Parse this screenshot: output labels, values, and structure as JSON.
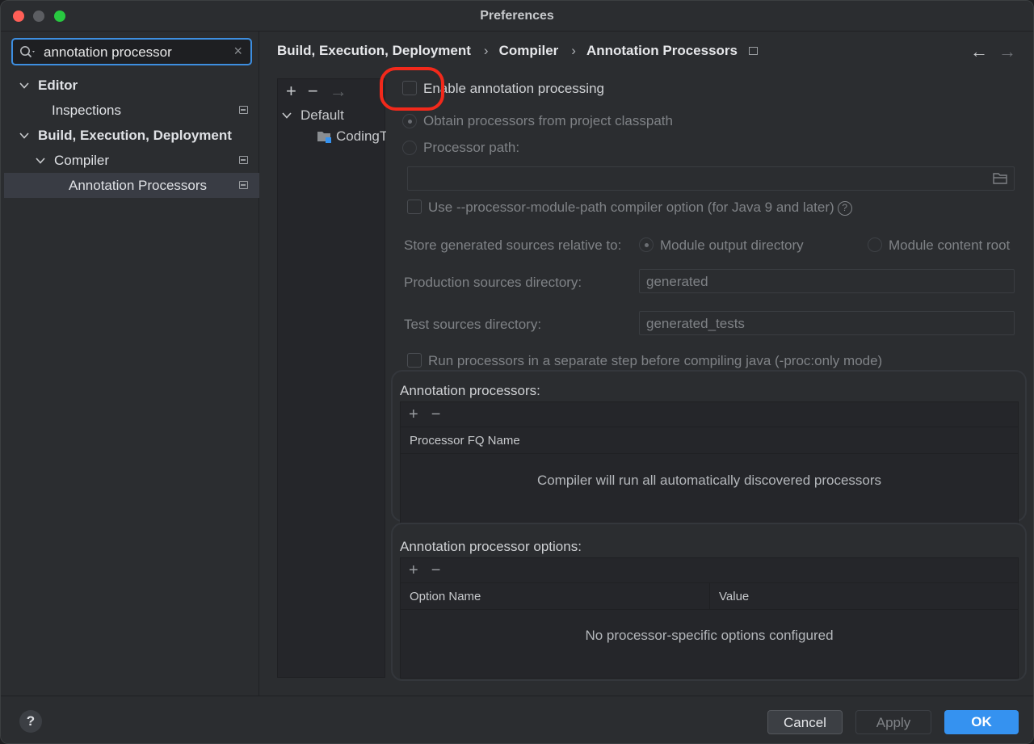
{
  "window": {
    "title": "Preferences"
  },
  "search": {
    "value": "annotation processor"
  },
  "sidebar": {
    "items": [
      {
        "label": "Editor"
      },
      {
        "label": "Inspections"
      },
      {
        "label": "Build, Execution, Deployment"
      },
      {
        "label": "Compiler"
      },
      {
        "label": "Annotation Processors"
      }
    ]
  },
  "breadcrumb": {
    "items": [
      "Build, Execution, Deployment",
      "Compiler",
      "Annotation Processors"
    ],
    "separator": "›"
  },
  "profiles": {
    "items": [
      {
        "label": "Default"
      },
      {
        "label": "CodingT"
      }
    ]
  },
  "settings": {
    "enable_annotation_processing": "Enable annotation processing",
    "obtain_from_classpath": "Obtain processors from project classpath",
    "processor_path": "Processor path:",
    "processor_module_path": "Use --processor-module-path compiler option (for Java 9 and later)",
    "store_generated_label": "Store generated sources relative to:",
    "module_output_dir": "Module output directory",
    "module_content_root": "Module content root",
    "production_dir_label": "Production sources directory:",
    "production_dir_value": "generated",
    "test_dir_label": "Test sources directory:",
    "test_dir_value": "generated_tests",
    "run_separate_step": "Run processors in a separate step before compiling java (-proc:only mode)"
  },
  "processors_group": {
    "title": "Annotation processors:",
    "column": "Processor FQ Name",
    "empty": "Compiler will run all automatically discovered processors"
  },
  "options_group": {
    "title": "Annotation processor options:",
    "col_name": "Option Name",
    "col_value": "Value",
    "empty": "No processor-specific options configured"
  },
  "buttons": {
    "help": "?",
    "cancel": "Cancel",
    "apply": "Apply",
    "ok": "OK"
  },
  "colors": {
    "accent": "#3592f0",
    "highlight_ring": "#f2291b",
    "background": "#2b2d30"
  }
}
